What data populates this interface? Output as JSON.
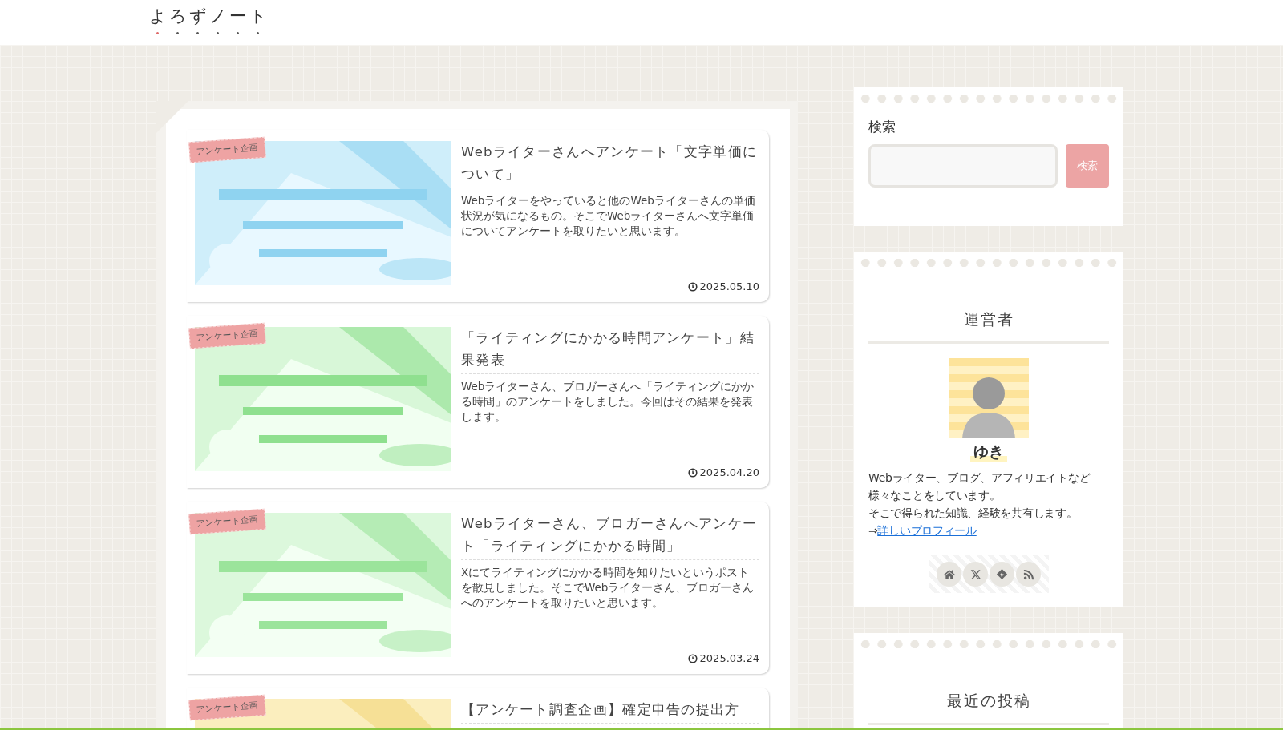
{
  "site": {
    "title": "よろずノート"
  },
  "posts": [
    {
      "category": "アンケート企画",
      "title": "Webライターさんへアンケート「文字単価について」",
      "excerpt": "Webライターをやっていると他のWebライターさんの単価状況が気になるもの。そこでWebライターさんへ文字単価についてアンケートを取りたいと思います。",
      "date": "2025.05.10"
    },
    {
      "category": "アンケート企画",
      "title": "「ライティングにかかる時間アンケート」結果発表",
      "excerpt": "Webライターさん、ブロガーさんへ「ライティングにかかる時間」のアンケートをしました。今回はその結果を発表します。",
      "date": "2025.04.20"
    },
    {
      "category": "アンケート企画",
      "title": "Webライターさん、ブロガーさんへアンケート「ライティングにかかる時間」",
      "excerpt": "Xにてライティングにかかる時間を知りたいというポストを散見しました。そこでWebライターさん、ブロガーさんへのアンケートを取りたいと思います。",
      "date": "2025.03.24"
    },
    {
      "category": "アンケート企画",
      "title": "【アンケート調査企画】確定申告の提出方"
    }
  ],
  "sidebar": {
    "search": {
      "heading": "検索",
      "button": "検索"
    },
    "profile": {
      "heading": "運営者",
      "name": "ゆき",
      "bio": [
        "Webライター、ブログ、アフィリエイトなど",
        "様々なことをしています。",
        "そこで得られた知識、経験を共有します。"
      ],
      "link_prefix": "⇒",
      "link": "詳しいプロフィール"
    },
    "recent": {
      "heading": "最近の投稿"
    }
  }
}
